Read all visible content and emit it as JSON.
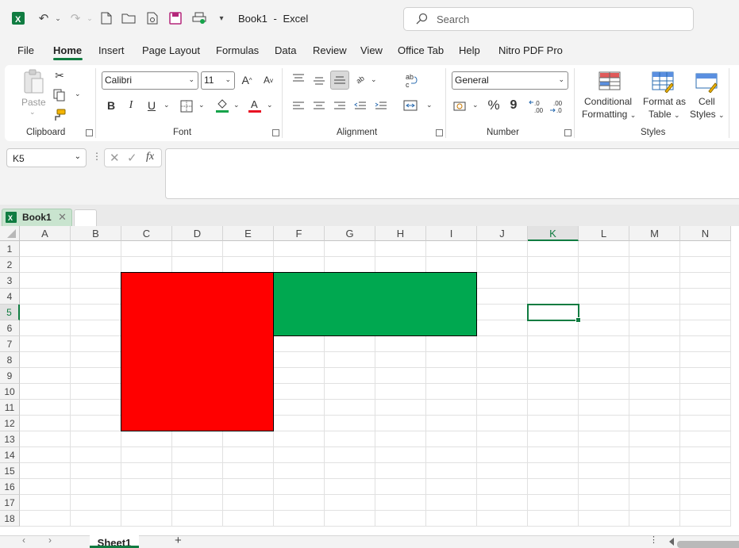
{
  "titlebar": {
    "book_title": "Book1",
    "separator": "-",
    "app_name": "Excel",
    "search_placeholder": "Search"
  },
  "menu": [
    "File",
    "Home",
    "Insert",
    "Page Layout",
    "Formulas",
    "Data",
    "Review",
    "View",
    "Office Tab",
    "Help",
    "Nitro PDF Pro"
  ],
  "active_menu": "Home",
  "ribbon": {
    "clipboard": {
      "label": "Clipboard",
      "paste": "Paste"
    },
    "font": {
      "label": "Font",
      "family": "Calibri",
      "size": "11",
      "bold": "B",
      "italic": "I",
      "underline": "U",
      "font_color": "#e81123",
      "highlight_color": "#16a34a"
    },
    "alignment": {
      "label": "Alignment"
    },
    "number": {
      "label": "Number",
      "format": "General",
      "percent": "%",
      "comma": "9"
    },
    "styles": {
      "label": "Styles",
      "conditional_1": "Conditional",
      "conditional_2": "Formatting",
      "format_table_1": "Format as",
      "format_table_2": "Table",
      "cell_styles_1": "Cell",
      "cell_styles_2": "Styles"
    }
  },
  "formula_bar": {
    "name_box": "K5",
    "formula": ""
  },
  "office_tab": {
    "book": "Book1"
  },
  "grid": {
    "columns": [
      "A",
      "B",
      "C",
      "D",
      "E",
      "F",
      "G",
      "H",
      "I",
      "J",
      "K",
      "L",
      "M",
      "N"
    ],
    "rows": [
      "1",
      "2",
      "3",
      "4",
      "5",
      "6",
      "7",
      "8",
      "9",
      "10",
      "11",
      "12",
      "13",
      "14",
      "15",
      "16",
      "17",
      "18"
    ],
    "selected_cell": "K5",
    "fills": [
      {
        "range": "C3:E12",
        "color": "#ff0000"
      },
      {
        "range": "F3:I6",
        "color": "#00a850"
      }
    ]
  },
  "sheets": {
    "active": "Sheet1",
    "add": "+"
  }
}
